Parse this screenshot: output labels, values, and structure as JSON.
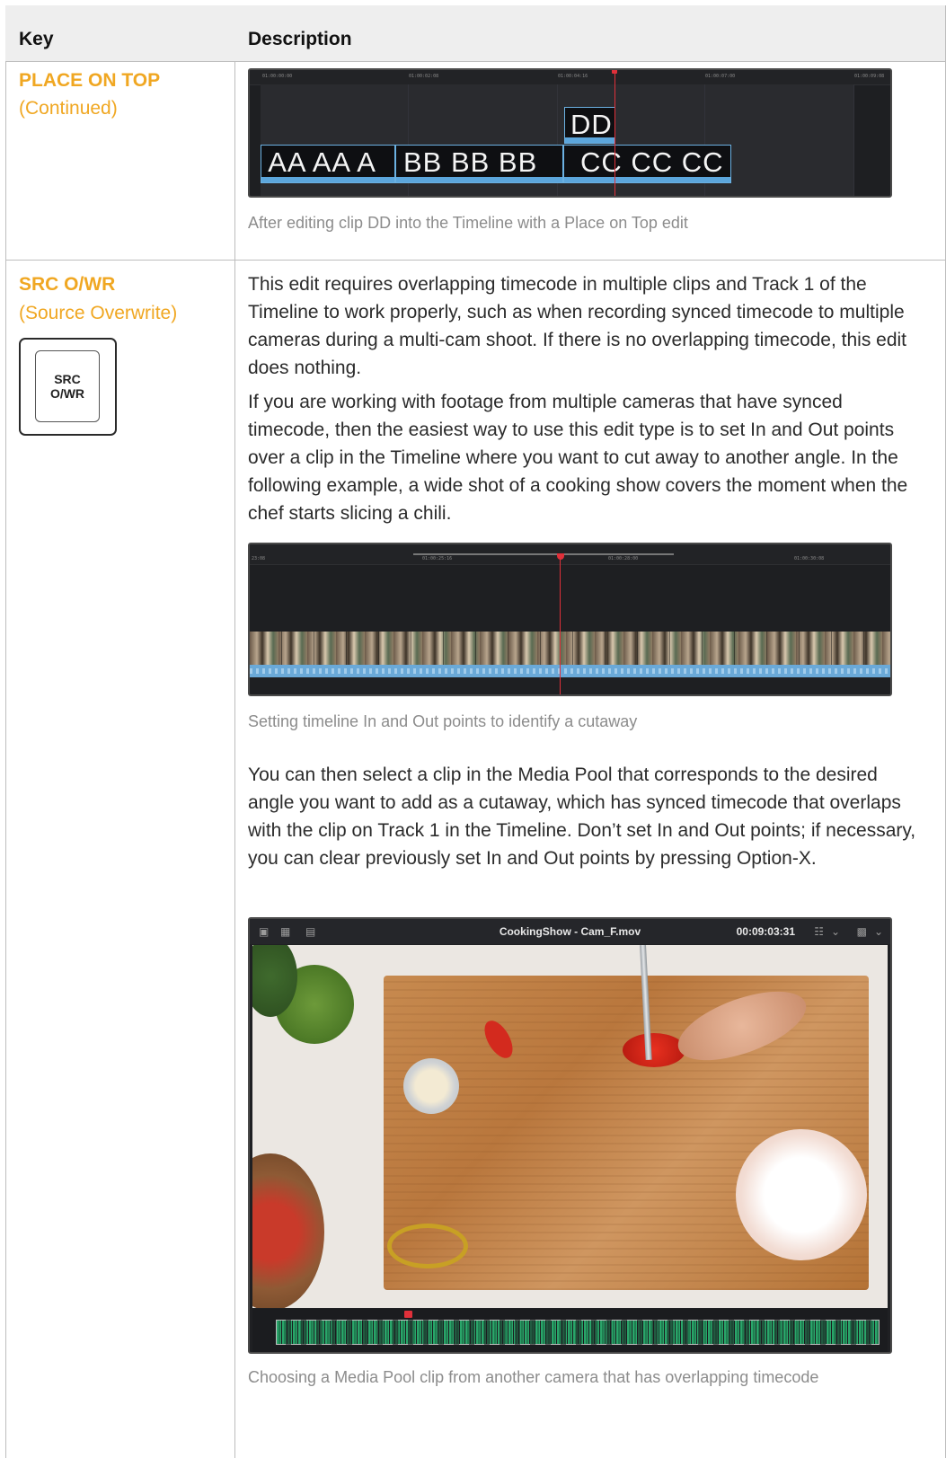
{
  "header": {
    "key": "Key",
    "description": "Description"
  },
  "rows": [
    {
      "key_title": "PLACE ON TOP",
      "key_subtitle": "(Continued)",
      "screenshot": {
        "timecodes": [
          "01:00:00:00",
          "01:00:02:08",
          "01:00:04:16",
          "01:00:07:00",
          "01:00:09:08"
        ],
        "clips": {
          "dd": "DD",
          "aa": " AA AA A",
          "bb": "BB BB BB",
          "cc": "CC CC CC"
        }
      },
      "caption": "After editing clip DD into the Timeline with a Place on Top edit"
    },
    {
      "key_title": "SRC O/WR",
      "key_subtitle": "(Source Overwrite)",
      "keycap": [
        "SRC",
        "O/WR"
      ],
      "paragraphs": [
        "This edit requires overlapping timecode in multiple clips and Track 1 of the Timeline to work properly, such as when recording synced timecode to multiple cameras during a multi-cam shoot. If there is no overlapping timecode, this edit does nothing.",
        "If you are working with footage from multiple cameras that have synced timecode, then the easiest way to use this edit type is to set In and Out points over a clip in the Timeline where you want to cut away to another angle. In the following example, a wide shot of a cooking show covers the moment when the chef starts slicing a chili."
      ],
      "timeline2": {
        "timecodes": [
          "23:08",
          "01:00:25:16",
          "01:00:28:00",
          "01:00:30:08"
        ]
      },
      "caption2": "Setting timeline In and Out points to identify a cutaway",
      "paragraph3": "You can then select a clip in the Media Pool that corresponds to the desired angle you want to add as a cutaway, which has synced timecode that overlaps with the clip on Track 1 in the Timeline. Don’t set In and Out points; if necessary, you can clear previously set In and Out points by pressing Option-X.",
      "viewer": {
        "title": "CookingShow - Cam_F.mov",
        "timecode": "00:09:03:31"
      },
      "caption3": "Choosing a Media Pool clip from another camera that has overlapping timecode"
    }
  ]
}
